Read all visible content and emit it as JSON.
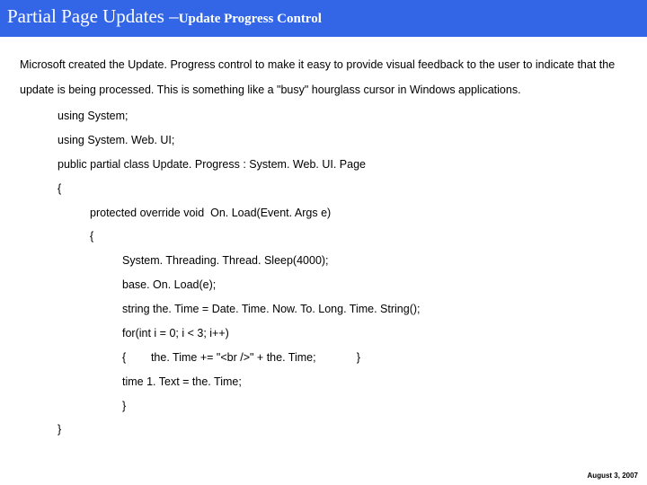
{
  "header": {
    "title_main": "Partial Page Updates ",
    "title_dash": "–",
    "title_sub": "Update Progress Control"
  },
  "paragraph": "Microsoft created the Update. Progress control to make it easy to provide visual feedback to the user to indicate that the update is being processed. This is something like a \"busy\" hourglass cursor in Windows applications.",
  "code": {
    "l1": "using System;",
    "l2": "using System. Web. UI;",
    "l3": "public partial class Update. Progress : System. Web. UI. Page",
    "l4": "{",
    "l5": "protected override void  On. Load(Event. Args e)",
    "l6": "{",
    "l7": "System. Threading. Thread. Sleep(4000);",
    "l8": "base. On. Load(e);",
    "l9": "string the. Time = Date. Time. Now. To. Long. Time. String();",
    "l10": "for(int i = 0; i < 3; i++)",
    "l11": "{        the. Time += \"<br />\" + the. Time;             }",
    "l12": "time 1. Text = the. Time;",
    "l13": "}",
    "l14": "}"
  },
  "footer": "August 3, 2007"
}
